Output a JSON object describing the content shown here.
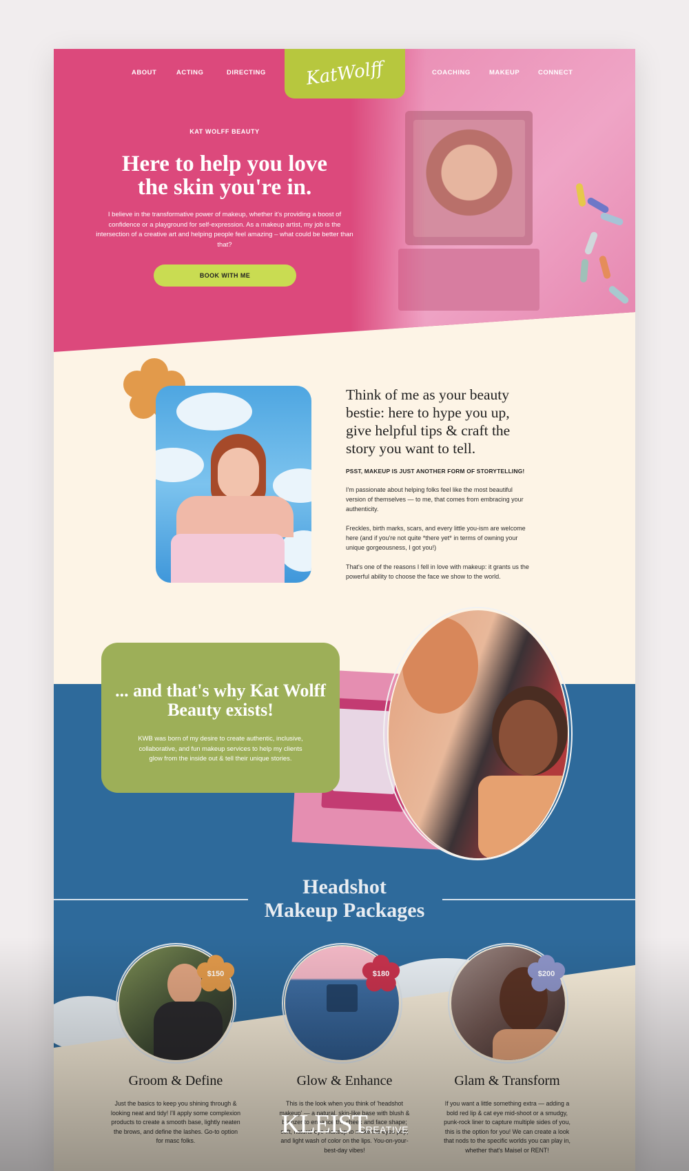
{
  "nav": {
    "left": [
      "ABOUT",
      "ACTING",
      "DIRECTING"
    ],
    "right": [
      "COACHING",
      "MAKEUP",
      "CONNECT"
    ],
    "logo": "KatWolff"
  },
  "hero": {
    "eyebrow": "KAT WOLFF BEAUTY",
    "title_line1": "Here to help you love",
    "title_line2": "the skin you're in.",
    "body": "I believe in the transformative power of makeup, whether it's providing a boost of confidence or a playground for self-expression. As a makeup artist, my job is the intersection of a creative art and helping people feel amazing – what could be better than that?",
    "cta": "BOOK WITH ME"
  },
  "about": {
    "title": "Think of me as your beauty bestie: here to hype you up, give helpful tips & craft the story you want to tell.",
    "eyebrow": "PSST, MAKEUP IS JUST ANOTHER FORM OF STORYTELLING!",
    "p1": "I'm passionate about helping folks feel like the most beautiful version of themselves — to me, that comes from embracing your authenticity.",
    "p2": "Freckles, birth marks, scars, and every little you-ism are welcome here (and if you're not quite *there yet* in terms of owning your unique gorgeousness, I got you!)",
    "p3": "That's one of the reasons I fell in love with makeup: it grants us the powerful ability to choose the face we show to the world."
  },
  "kwb": {
    "title": "... and that's why Kat Wolff Beauty exists!",
    "body": "KWB was born of my desire to create authentic, inclusive, collaborative, and fun makeup services to help my clients glow from the inside out & tell their unique stories."
  },
  "packages_section": {
    "title_line1": "Headshot",
    "title_line2": "Makeup Packages"
  },
  "packages": [
    {
      "price": "$150",
      "name": "Groom & Define",
      "desc": "Just the basics to keep you shining through & looking neat and tidy! I'll apply some complexion products to create a smooth base, lightly neaten the brows, and define the lashes. Go-to option for masc folks."
    },
    {
      "price": "$180",
      "name": "Glow & Enhance",
      "desc": "This is the look when you think of 'headshot makeup' — a natural, skin-like base with blush & bronzer to enhance the cheek and face shape; soft, natural eye makeup to make the eyes pop; and light wash of color on the lips. You-on-your-best-day vibes!"
    },
    {
      "price": "$200",
      "name": "Glam & Transform",
      "desc": "If you want a little something extra — adding a bold red lip & cat eye mid-shoot or a smudgy, punk-rock liner to capture multiple sides of you, this is the option for you! We can create a look that nods to the specific worlds you can play in, whether that's Maisel or RENT!"
    }
  ],
  "watermark": {
    "main": "KLEIST",
    "sub": "CREATIVE"
  },
  "colors": {
    "hero_pink": "#dc497c",
    "lime": "#c9dc52",
    "cream": "#fdf4e6",
    "olive": "#9daf58",
    "blue": "#2e6a9b",
    "orange_flower": "#e29a4b",
    "red_flower": "#c8334e",
    "lavender_flower": "#8e95c9"
  }
}
